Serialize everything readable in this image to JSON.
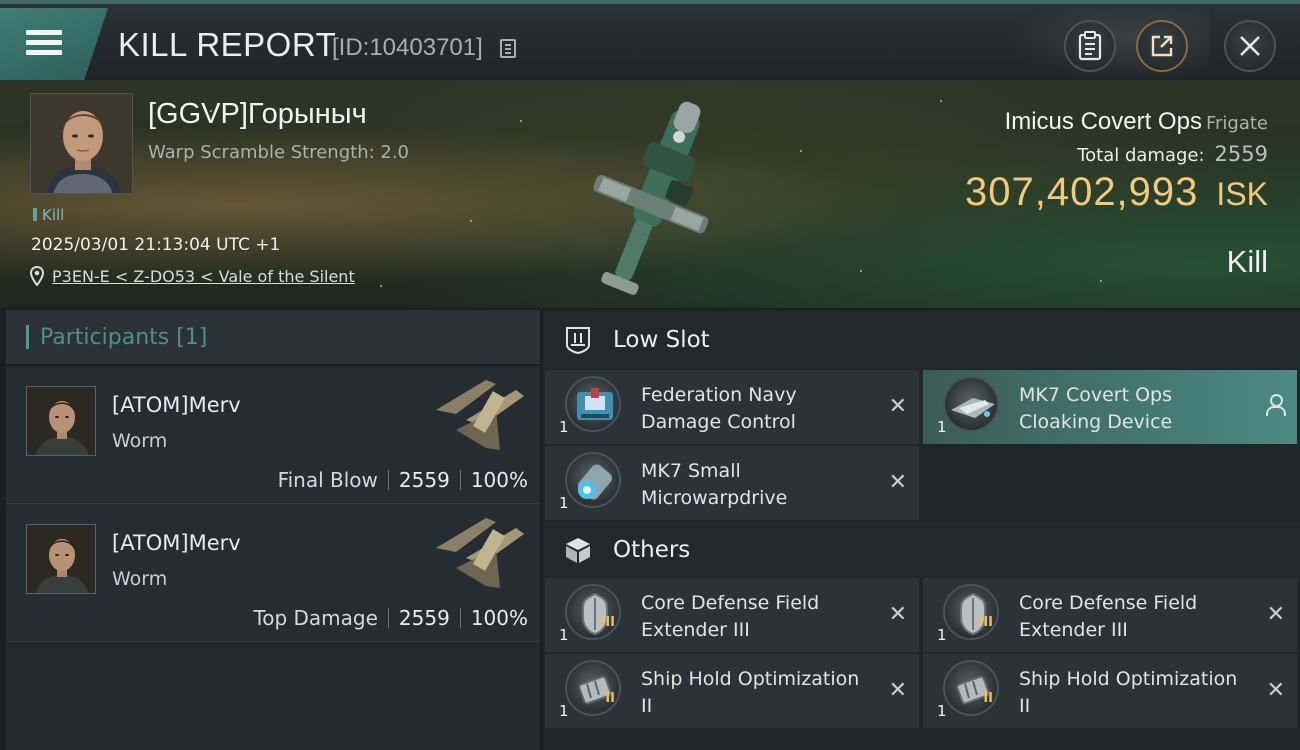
{
  "header": {
    "title": "KILL REPORT",
    "report_id": "[ID:10403701]",
    "icons": [
      "menu-icon",
      "copy-icon",
      "clipboard-icon",
      "share-icon",
      "close-icon"
    ]
  },
  "victim": {
    "name": "[GGVP]Горыныч",
    "warp_scramble": "Warp Scramble Strength: 2.0",
    "tag": "Kill",
    "datetime": "2025/03/01 21:13:04 UTC +1",
    "location": "P3EN-E < Z-DO53 < Vale of the Silent",
    "ship_name": "Imicus Covert Ops",
    "ship_class": "Frigate",
    "total_damage_label": "Total damage:",
    "total_damage": "2559",
    "isk_value": "307,402,993",
    "isk_unit": "ISK",
    "result": "Kill"
  },
  "participants": {
    "title": "Participants [1]",
    "items": [
      {
        "name": "[ATOM]Merv",
        "ship": "Worm",
        "label": "Final Blow",
        "damage": "2559",
        "percent": "100%"
      },
      {
        "name": "[ATOM]Merv",
        "ship": "Worm",
        "label": "Top Damage",
        "damage": "2559",
        "percent": "100%"
      }
    ]
  },
  "fitting": {
    "low_slot": {
      "title": "Low Slot",
      "modules": [
        {
          "name": "Federation Navy Damage Control",
          "qty": "1",
          "status": "destroyed"
        },
        {
          "name": "MK7 Covert Ops Cloaking Device",
          "qty": "1",
          "status": "dropped"
        },
        {
          "name": "MK7 Small Microwarpdrive",
          "qty": "1",
          "status": "destroyed"
        }
      ]
    },
    "others": {
      "title": "Others",
      "modules": [
        {
          "name": "Core Defense Field Extender III",
          "qty": "1",
          "tier": "III",
          "status": "destroyed"
        },
        {
          "name": "Core Defense Field Extender III",
          "qty": "1",
          "tier": "III",
          "status": "destroyed"
        },
        {
          "name": "Ship Hold Optimization II",
          "qty": "1",
          "tier": "II",
          "status": "destroyed"
        },
        {
          "name": "Ship Hold Optimization II",
          "qty": "1",
          "tier": "II",
          "status": "destroyed"
        }
      ]
    },
    "destroyed_mark": "✕"
  },
  "colors": {
    "accent": "#4d9a92",
    "isk": "#f3c97a",
    "highlight": "#4b8a82"
  }
}
